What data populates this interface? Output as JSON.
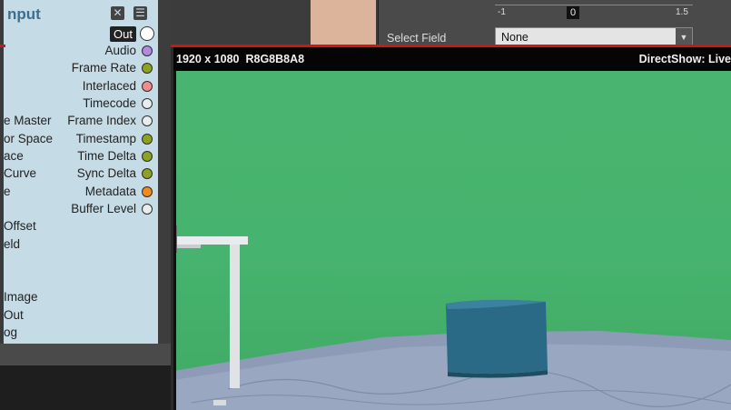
{
  "node": {
    "title": "nput",
    "out_port": "Out",
    "ports": [
      {
        "label": "Audio",
        "color": "#b48ae0"
      },
      {
        "label": "Frame Rate",
        "color": "#8da21f"
      },
      {
        "label": "Interlaced",
        "color": "#f08c8c"
      },
      {
        "label": "Timecode",
        "color": "#e8eef0"
      },
      {
        "label": "Frame Index",
        "color": "#e8eef0"
      },
      {
        "label": "Timestamp",
        "color": "#8da21f"
      },
      {
        "label": "Time Delta",
        "color": "#8da21f"
      },
      {
        "label": "Sync Delta",
        "color": "#8da21f"
      },
      {
        "label": "Metadata",
        "color": "#f08a1c"
      },
      {
        "label": "Buffer Level",
        "color": "#e8eef0"
      }
    ],
    "params": [
      "e Master",
      "or Space",
      "ace",
      "Curve",
      "e",
      "Offset",
      "eld",
      "Image",
      "Out",
      "og"
    ]
  },
  "props": {
    "slider_min": "-1",
    "slider_value": "0",
    "slider_max": "1.5",
    "select_label": "Select Field",
    "select_value": "None"
  },
  "viewer": {
    "resolution": "1920 x 1080",
    "format": "R8G8B8A8",
    "source": "DirectShow: Live"
  },
  "colors": {
    "accent_red": "#d31414",
    "green_screen": "#47b36e",
    "node_panel": "#c5dbe6"
  }
}
